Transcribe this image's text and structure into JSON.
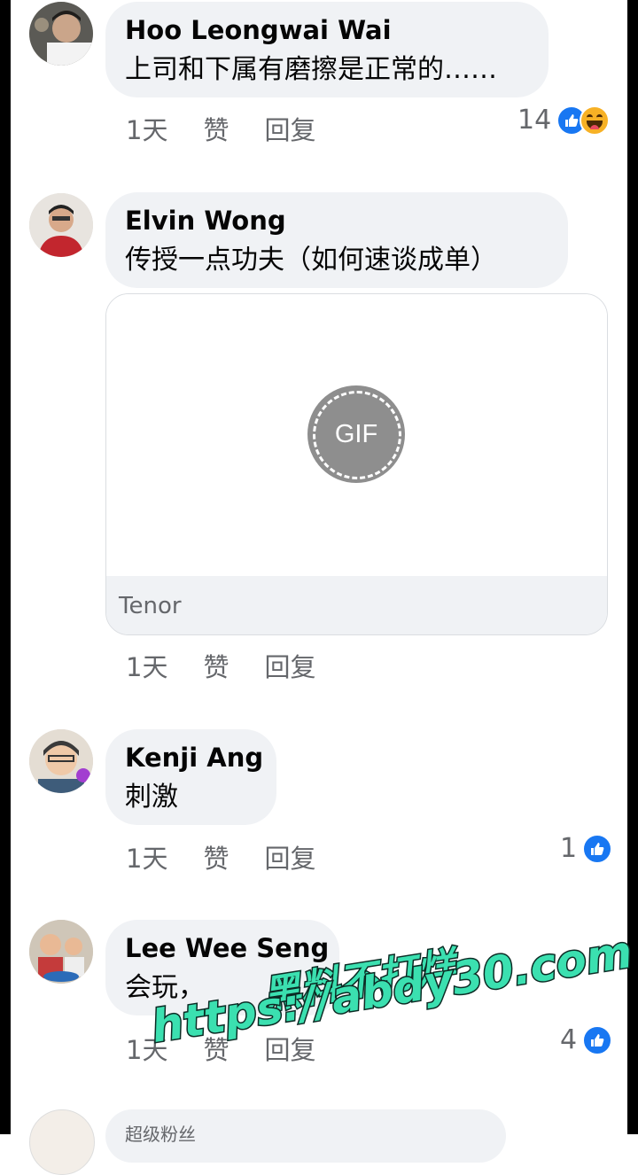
{
  "comments": [
    {
      "author": "Hoo Leongwai Wai",
      "text": "上司和下属有磨擦是正常的……",
      "time": "1天",
      "like_label": "赞",
      "reply_label": "回复",
      "reaction_count": "14",
      "reactions": [
        "like-icon",
        "haha-icon"
      ]
    },
    {
      "author": "Elvin Wong",
      "text": "传授一点功夫（如何速谈成单）",
      "time": "1天",
      "like_label": "赞",
      "reply_label": "回复",
      "gif": {
        "badge": "GIF",
        "source": "Tenor"
      }
    },
    {
      "author": "Kenji Ang",
      "text": "刺激",
      "time": "1天",
      "like_label": "赞",
      "reply_label": "回复",
      "reaction_count": "1",
      "reactions": [
        "like-icon"
      ]
    },
    {
      "author": "Lee Wee Seng",
      "text": "会玩，",
      "time": "1天",
      "like_label": "赞",
      "reply_label": "回复",
      "reaction_count": "4",
      "reactions": [
        "like-icon"
      ]
    }
  ],
  "next_comment_badge": "超级粉丝",
  "watermark": {
    "line1": "黑料不打烊",
    "line2": "https://abdy30.com"
  },
  "colors": {
    "bubble": "#f0f2f5",
    "like": "#1877f2",
    "meta": "#65676b",
    "watermark": "#3be0b0"
  }
}
